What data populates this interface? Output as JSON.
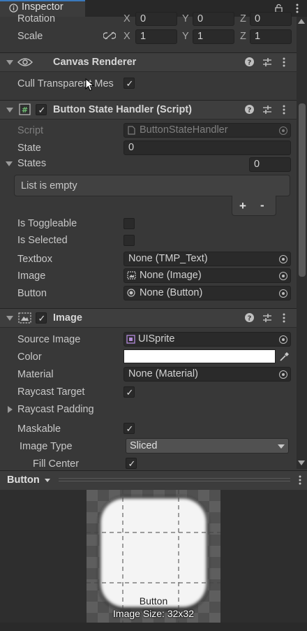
{
  "tab": {
    "title": "Inspector",
    "lock_icon": "lock-icon",
    "menu_icon": "kebab-menu-icon"
  },
  "transform": {
    "rotation_label": "Rotation",
    "rotation": {
      "x": "0",
      "y": "0",
      "z": "0"
    },
    "scale_label": "Scale",
    "scale": {
      "x": "1",
      "y": "1",
      "z": "1"
    },
    "axis_x": "X",
    "axis_y": "Y",
    "axis_z": "Z"
  },
  "canvas_renderer": {
    "title": "Canvas Renderer",
    "cull_label": "Cull Transparent Mes",
    "cull_checked": true
  },
  "button_state_handler": {
    "title": "Button State Handler (Script)",
    "script_label": "Script",
    "script_value": "ButtonStateHandler",
    "state_label": "State",
    "state_value": "0",
    "states_label": "States",
    "states_count": "0",
    "list_empty": "List is empty",
    "add_label": "+",
    "remove_label": "-",
    "toggleable_label": "Is Toggleable",
    "selected_label": "Is Selected",
    "textbox_label": "Textbox",
    "textbox_value": "None (TMP_Text)",
    "image_label": "Image",
    "image_value": "None (Image)",
    "button_label": "Button",
    "button_value": "None (Button)"
  },
  "image_component": {
    "title": "Image",
    "source_label": "Source Image",
    "source_value": "UISprite",
    "color_label": "Color",
    "color_value": "#ffffff",
    "material_label": "Material",
    "material_value": "None (Material)",
    "raycast_target_label": "Raycast Target",
    "raycast_padding_label": "Raycast Padding",
    "maskable_label": "Maskable",
    "image_type_label": "Image Type",
    "image_type_value": "Sliced",
    "fill_center_label": "Fill Center"
  },
  "preview": {
    "title": "Button",
    "caption_name": "Button",
    "caption_size": "Image Size: 32x32"
  },
  "colors": {
    "accent": "#3a79bb",
    "panel": "#383838",
    "field": "#2a2a2a"
  }
}
